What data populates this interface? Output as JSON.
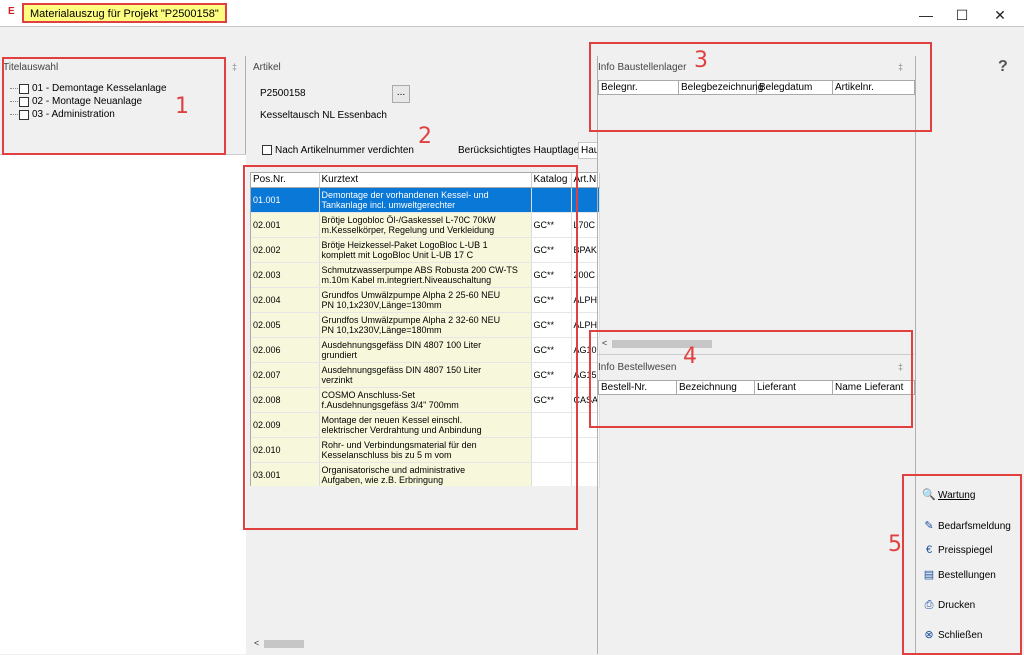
{
  "window": {
    "title": "Materialauszug für Projekt \"P2500158\"",
    "app_icon": "E",
    "controls": {
      "minimize": "—",
      "maximize": "☐",
      "close": "✕"
    },
    "help": "?"
  },
  "left_panel": {
    "title": "Titelauswahl",
    "pin": "‡",
    "items": [
      {
        "label": "01 - Demontage Kesselanlage"
      },
      {
        "label": "02 - Montage Neuanlage"
      },
      {
        "label": "03 - Administration"
      }
    ]
  },
  "article_panel": {
    "title": "Artikel",
    "project_value": "P2500158",
    "browse_label": "...",
    "description_value": "Kesseltausch NL Essenbach",
    "compress_label": "Nach Artikelnummer verdichten",
    "main_store_label": "Berücksichtigtes Hauptlager",
    "main_store_value": "Hau"
  },
  "positions_table": {
    "headers": [
      "Pos.Nr.",
      "Kurztext",
      "Katalog",
      "Art.N"
    ],
    "rows": [
      {
        "pos": "01.001",
        "l1": "Demontage der vorhandenen Kessel- und",
        "l2": "Tankanlage incl. umweltgerechter",
        "cat": "",
        "art": ""
      },
      {
        "pos": "02.001",
        "l1": "Brötje Logobloc Öl-/Gaskessel L-70C 70kW",
        "l2": "m.Kesselkörper, Regelung und Verkleidung",
        "cat": "GC**",
        "art": "L70C"
      },
      {
        "pos": "02.002",
        "l1": "Brötje Heizkessel-Paket LogoBloc L-UB 1",
        "l2": "komplett mit LogoBloc Unit L-UB 17 C",
        "cat": "GC**",
        "art": "BPAK"
      },
      {
        "pos": "02.003",
        "l1": "Schmutzwasserpumpe ABS Robusta 200 CW-TS",
        "l2": "m.10m Kabel m.integriert.Niveauschaltung",
        "cat": "GC**",
        "art": "200C"
      },
      {
        "pos": "02.004",
        "l1": "Grundfos Umwälzpumpe Alpha 2 25-60 NEU",
        "l2": "PN 10,1x230V,Länge=130mm",
        "cat": "GC**",
        "art": "ALPH"
      },
      {
        "pos": "02.005",
        "l1": "Grundfos Umwälzpumpe Alpha 2 32-60 NEU",
        "l2": "PN 10,1x230V,Länge=180mm",
        "cat": "GC**",
        "art": "ALPH"
      },
      {
        "pos": "02.006",
        "l1": "Ausdehnungsgefäss DIN 4807 100 Liter",
        "l2": "grundiert",
        "cat": "GC**",
        "art": "AG10"
      },
      {
        "pos": "02.007",
        "l1": "Ausdehnungsgefäss DIN 4807 150 Liter",
        "l2": "verzinkt",
        "cat": "GC**",
        "art": "AG15"
      },
      {
        "pos": "02.008",
        "l1": "COSMO Anschluss-Set",
        "l2": "f.Ausdehnungsgefäss 3/4\" 700mm",
        "cat": "GC**",
        "art": "CASA"
      },
      {
        "pos": "02.009",
        "l1": "Montage der neuen Kessel einschl.",
        "l2": "elektrischer Verdrahtung und Anbindung",
        "cat": "",
        "art": ""
      },
      {
        "pos": "02.010",
        "l1": "Rohr- und Verbindungsmaterial für den",
        "l2": "Kesselanschluss bis zu 5 m vom",
        "cat": "",
        "art": ""
      },
      {
        "pos": "03.001",
        "l1": "Organisatorische und administrative",
        "l2": "Aufgaben, wie z.B. Erbringung",
        "cat": "",
        "art": ""
      }
    ]
  },
  "info_lager": {
    "title": "Info Baustellenlager",
    "pin": "‡",
    "headers": [
      "Belegnr.",
      "Belegbezeichnung",
      "Belegdatum",
      "Artikelnr."
    ]
  },
  "info_bestell": {
    "title": "Info Bestellwesen",
    "pin": "‡",
    "headers": [
      "Bestell-Nr.",
      "Bezeichnung",
      "Lieferant",
      "Name Lieferant"
    ]
  },
  "actions": {
    "wartung": "Wartung",
    "bedarf": "Bedarfsmeldung",
    "preis": "Preisspiegel",
    "bestellungen": "Bestellungen",
    "drucken": "Drucken",
    "schliessen": "Schließen"
  },
  "annotations": [
    "1",
    "2",
    "3",
    "4",
    "5"
  ],
  "scroll": {
    "left": "<"
  },
  "colors": {
    "annotation": "#e04040",
    "selection": "#0a78d7",
    "row_bg": "#f7f7dc",
    "title_highlight": "#fefe80"
  }
}
